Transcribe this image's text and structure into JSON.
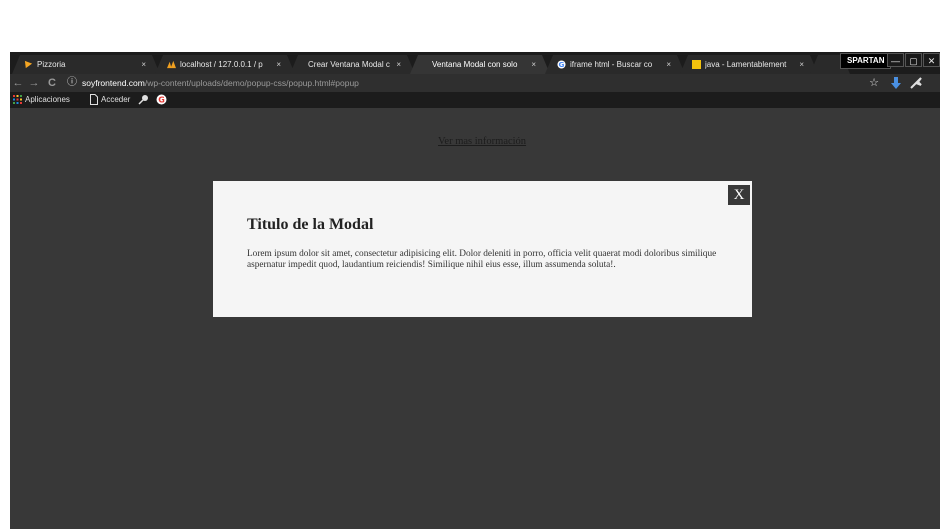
{
  "tabs": [
    {
      "label": "Pizzoria",
      "icon": "pizza-icon",
      "close": "×"
    },
    {
      "label": "localhost / 127.0.0.1 / p",
      "icon": "phpmyadmin-icon",
      "close": "×"
    },
    {
      "label": "Crear Ventana Modal c",
      "icon": "",
      "close": "×"
    },
    {
      "label": "Ventana Modal con solo",
      "icon": "",
      "close": "×",
      "active": true
    },
    {
      "label": "iframe html - Buscar co",
      "icon": "google-icon",
      "close": "×"
    },
    {
      "label": "java - Lamentablement",
      "icon": "stackoverflow-icon",
      "close": "×"
    }
  ],
  "window": {
    "profile": "SPARTAN",
    "minimize": "—",
    "restore": "▢",
    "close": "✕"
  },
  "nav": {
    "back": "←",
    "forward": "→",
    "reload": "C",
    "info": "ⓘ",
    "url_host": "soyfrontend.com",
    "url_path": "/wp-content/uploads/demo/popup-css/popup.html#popup",
    "star": "☆"
  },
  "bookmarks": {
    "apps": "Aplicaciones",
    "acceder": "Acceder"
  },
  "page": {
    "link": "Ver mas información",
    "modal": {
      "close": "X",
      "title": "Titulo de la Modal",
      "body": "Lorem ipsum dolor sit amet, consectetur adipisicing elit. Dolor deleniti in porro, officia velit quaerat modi doloribus similique aspernatur impedit quod, laudantium reiciendis! Similique nihil eius esse, illum assumenda soluta!."
    }
  },
  "colors": {
    "overlay": "#383838",
    "modal_bg": "#f5f5f5",
    "accent_blue": "#4a90e2"
  }
}
